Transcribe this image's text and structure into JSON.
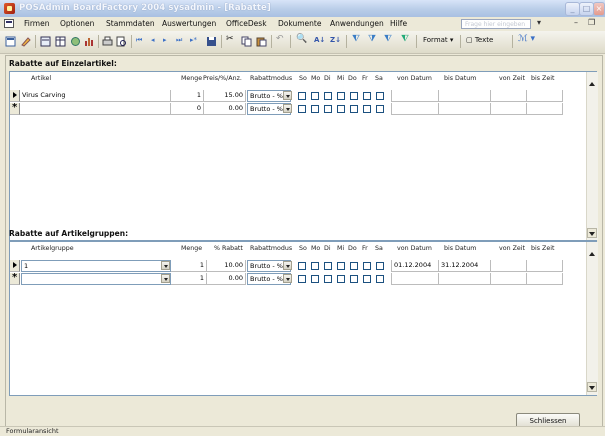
{
  "window": {
    "title": "POSAdmin BoardFactory 2004 sysadmin - [Rabatte]"
  },
  "menu": {
    "items": [
      "Firmen",
      "Optionen",
      "Stammdaten",
      "Auswertungen",
      "OfficeDesk",
      "Dokumente",
      "Anwendungen",
      "Hilfe"
    ],
    "help_placeholder": "Frage hier eingeben"
  },
  "toolbar": {
    "format_label": "Format",
    "texte_label": "Texte"
  },
  "section1": {
    "title": "Rabatte auf Einzelartikel:",
    "columns": [
      "Artikel",
      "Menge",
      "Preis/%/Anz.",
      "Rabattmodus",
      "So",
      "Mo",
      "Di",
      "Mi",
      "Do",
      "Fr",
      "Sa",
      "von Datum",
      "bis Datum",
      "von Zeit",
      "bis Zeit"
    ],
    "rows": [
      {
        "artikel": "Virus Carving",
        "menge": "1",
        "preis": "15.00",
        "modus": "Brutto - %"
      },
      {
        "artikel": "",
        "menge": "0",
        "preis": "0.00",
        "modus": "Brutto - %"
      }
    ]
  },
  "section2": {
    "title": "Rabatte auf Artikelgruppen:",
    "columns": [
      "Artikelgruppe",
      "Menge",
      "% Rabatt",
      "Rabattmodus",
      "So",
      "Mo",
      "Di",
      "Mi",
      "Do",
      "Fr",
      "Sa",
      "von Datum",
      "bis Datum",
      "von Zeit",
      "bis Zeit"
    ],
    "rows": [
      {
        "gruppe": "1",
        "menge": "1",
        "rabatt": "10.00",
        "modus": "Brutto - %",
        "von_datum": "01.12.2004",
        "bis_datum": "31.12.2004"
      },
      {
        "gruppe": "",
        "menge": "1",
        "rabatt": "0.00",
        "modus": "Brutto - %",
        "von_datum": "",
        "bis_datum": ""
      }
    ]
  },
  "close_button": "Schliessen",
  "status": "Formularansicht"
}
